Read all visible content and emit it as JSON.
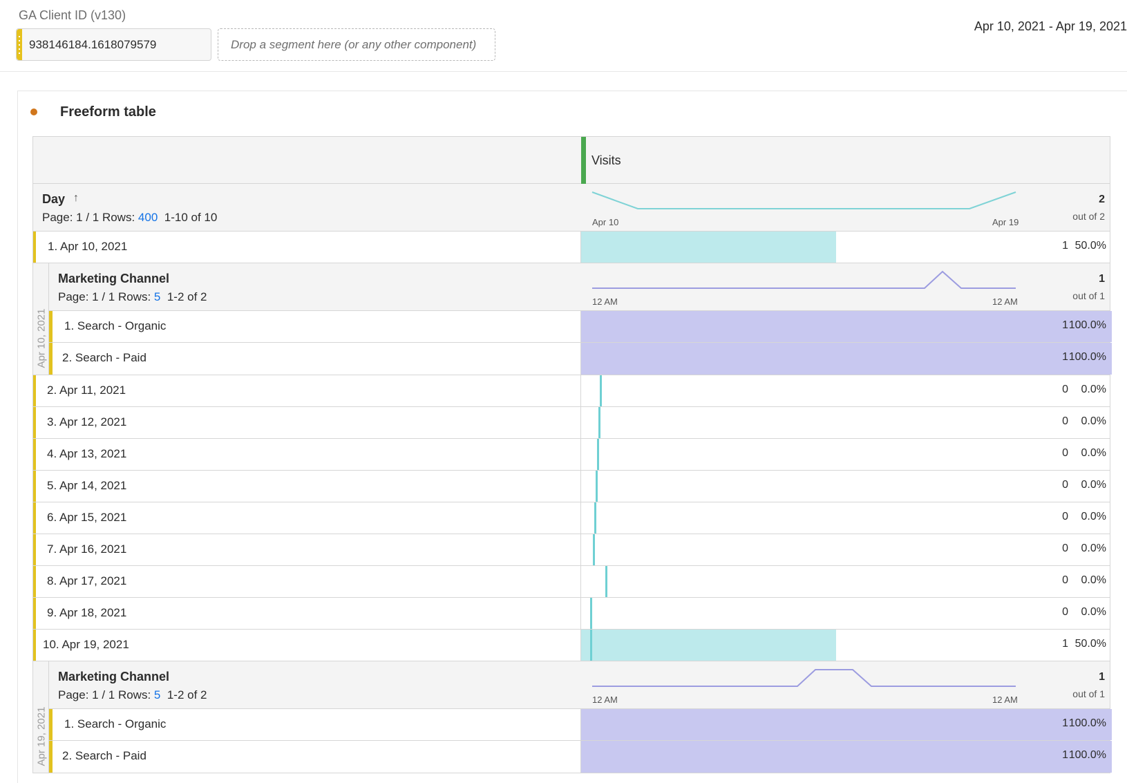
{
  "segment_bar": {
    "label": "GA Client ID (v130)",
    "segment_value": "938146184.1618079579",
    "drop_placeholder": "Drop a segment here (or any other component)",
    "date_range": "Apr 10, 2021 - Apr 19, 2021"
  },
  "panel": {
    "title": "Freeform table",
    "dot_color": "#d0761c"
  },
  "table": {
    "metric": {
      "name": "Visits",
      "color": "#4aa84f"
    },
    "dimension": {
      "name": "Day",
      "sort_icon": "arrow-up-icon",
      "pager_prefix": "Page: 1 / 1  Rows:",
      "rows_per_page": "400",
      "range": "1-10 of 10",
      "spark_start": "Apr 10",
      "spark_end": "Apr 19",
      "total": "2",
      "total_of": "out of 2"
    },
    "rows": [
      {
        "index": "1.",
        "label": "Apr 10, 2021",
        "value": "1",
        "pct": "50.0%",
        "share": 0.5
      },
      {
        "index": "2.",
        "label": "Apr 11, 2021",
        "value": "0",
        "pct": "0.0%",
        "share": 0.0
      },
      {
        "index": "3.",
        "label": "Apr 12, 2021",
        "value": "0",
        "pct": "0.0%",
        "share": 0.0
      },
      {
        "index": "4.",
        "label": "Apr 13, 2021",
        "value": "0",
        "pct": "0.0%",
        "share": 0.0
      },
      {
        "index": "5.",
        "label": "Apr 14, 2021",
        "value": "0",
        "pct": "0.0%",
        "share": 0.0
      },
      {
        "index": "6.",
        "label": "Apr 15, 2021",
        "value": "0",
        "pct": "0.0%",
        "share": 0.0
      },
      {
        "index": "7.",
        "label": "Apr 16, 2021",
        "value": "0",
        "pct": "0.0%",
        "share": 0.0
      },
      {
        "index": "8.",
        "label": "Apr 17, 2021",
        "value": "0",
        "pct": "0.0%",
        "share": 0.0
      },
      {
        "index": "9.",
        "label": "Apr 18, 2021",
        "value": "0",
        "pct": "0.0%",
        "share": 0.0
      },
      {
        "index": "10.",
        "label": "Apr 19, 2021",
        "value": "1",
        "pct": "50.0%",
        "share": 0.5
      }
    ],
    "breakdowns": [
      {
        "parent": "Apr 10, 2021",
        "name": "Marketing Channel",
        "pager_prefix": "Page: 1 / 1  Rows:",
        "rows_per_page": "5",
        "range": "1-2 of 2",
        "spark_start": "12 AM",
        "spark_end": "12 AM",
        "total": "1",
        "total_of": "out of 1",
        "rows": [
          {
            "index": "1.",
            "label": "Search - Organic",
            "value": "1",
            "pct": "100.0%",
            "share": 1.0
          },
          {
            "index": "2.",
            "label": "Search - Paid",
            "value": "1",
            "pct": "100.0%",
            "share": 1.0
          }
        ]
      },
      {
        "parent": "Apr 19, 2021",
        "name": "Marketing Channel",
        "pager_prefix": "Page: 1 / 1  Rows:",
        "rows_per_page": "5",
        "range": "1-2 of 2",
        "spark_start": "12 AM",
        "spark_end": "12 AM",
        "total": "1",
        "total_of": "out of 1",
        "rows": [
          {
            "index": "1.",
            "label": "Search - Organic",
            "value": "1",
            "pct": "100.0%",
            "share": 1.0
          },
          {
            "index": "2.",
            "label": "Search - Paid",
            "value": "1",
            "pct": "100.0%",
            "share": 1.0
          }
        ]
      }
    ],
    "colors": {
      "bar_day": "#bdeaec",
      "bar_channel": "#c8c8f0",
      "spark_day": "#7fd3d6",
      "spark_channel": "#9c9ce0",
      "row_accent": "#e2c21f"
    }
  }
}
